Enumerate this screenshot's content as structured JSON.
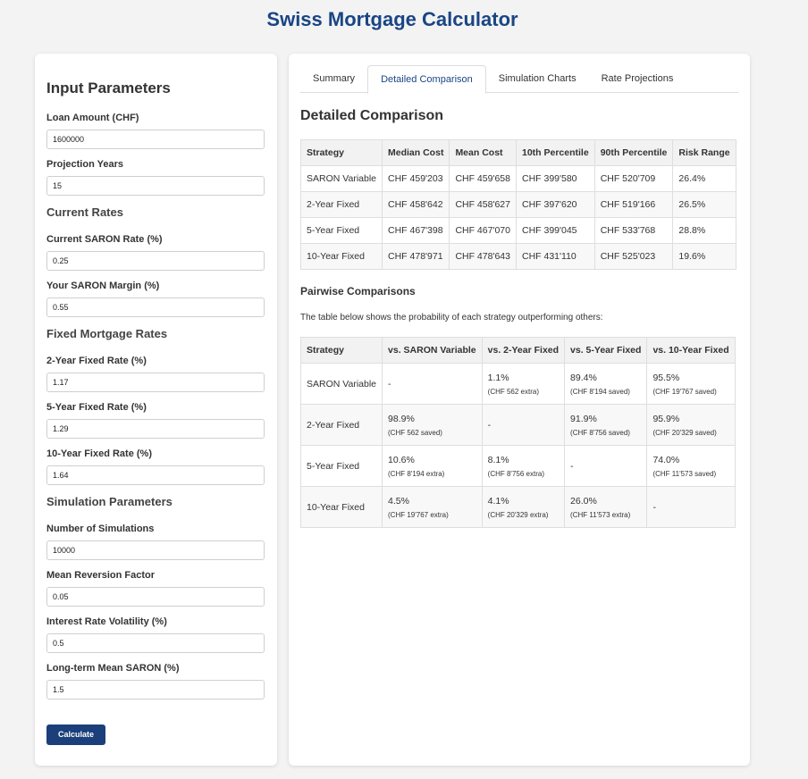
{
  "app": {
    "title": "Swiss Mortgage Calculator"
  },
  "sidebar": {
    "heading": "Input Parameters",
    "loan": {
      "label": "Loan Amount (CHF)",
      "value": "1600000"
    },
    "years": {
      "label": "Projection Years",
      "value": "15"
    },
    "current_rates_heading": "Current Rates",
    "saron": {
      "label": "Current SARON Rate (%)",
      "value": "0.25"
    },
    "margin": {
      "label": "Your SARON Margin (%)",
      "value": "0.55"
    },
    "fixed_heading": "Fixed Mortgage Rates",
    "fixed2": {
      "label": "2-Year Fixed Rate (%)",
      "value": "1.17"
    },
    "fixed5": {
      "label": "5-Year Fixed Rate (%)",
      "value": "1.29"
    },
    "fixed10": {
      "label": "10-Year Fixed Rate (%)",
      "value": "1.64"
    },
    "sim_heading": "Simulation Parameters",
    "nsims": {
      "label": "Number of Simulations",
      "value": "10000"
    },
    "reversion": {
      "label": "Mean Reversion Factor",
      "value": "0.05"
    },
    "volatility": {
      "label": "Interest Rate Volatility (%)",
      "value": "0.5"
    },
    "longterm": {
      "label": "Long-term Mean SARON (%)",
      "value": "1.5"
    },
    "calculate_label": "Calculate"
  },
  "tabs": [
    "Summary",
    "Detailed Comparison",
    "Simulation Charts",
    "Rate Projections"
  ],
  "active_tab": "Detailed Comparison",
  "main": {
    "title": "Detailed Comparison",
    "comparison": {
      "headers": [
        "Strategy",
        "Median Cost",
        "Mean Cost",
        "10th Percentile",
        "90th Percentile",
        "Risk Range"
      ],
      "rows": [
        [
          "SARON Variable",
          "CHF 459'203",
          "CHF 459'658",
          "CHF 399'580",
          "CHF 520'709",
          "26.4%"
        ],
        [
          "2-Year Fixed",
          "CHF 458'642",
          "CHF 458'627",
          "CHF 397'620",
          "CHF 519'166",
          "26.5%"
        ],
        [
          "5-Year Fixed",
          "CHF 467'398",
          "CHF 467'070",
          "CHF 399'045",
          "CHF 533'768",
          "28.8%"
        ],
        [
          "10-Year Fixed",
          "CHF 478'971",
          "CHF 478'643",
          "CHF 431'110",
          "CHF 525'023",
          "19.6%"
        ]
      ]
    },
    "pairwise_title": "Pairwise Comparisons",
    "pairwise_desc": "The table below shows the probability of each strategy outperforming others:",
    "pairwise": {
      "headers": [
        "Strategy",
        "vs. SARON Variable",
        "vs. 2-Year Fixed",
        "vs. 5-Year Fixed",
        "vs. 10-Year Fixed"
      ],
      "rows": [
        {
          "strategy": "SARON Variable",
          "cells": [
            {
              "pct": "-",
              "note": ""
            },
            {
              "pct": "1.1%",
              "note": "(CHF 562 extra)"
            },
            {
              "pct": "89.4%",
              "note": "(CHF 8'194 saved)"
            },
            {
              "pct": "95.5%",
              "note": "(CHF 19'767 saved)"
            }
          ]
        },
        {
          "strategy": "2-Year Fixed",
          "cells": [
            {
              "pct": "98.9%",
              "note": "(CHF 562 saved)"
            },
            {
              "pct": "-",
              "note": ""
            },
            {
              "pct": "91.9%",
              "note": "(CHF 8'756 saved)"
            },
            {
              "pct": "95.9%",
              "note": "(CHF 20'329 saved)"
            }
          ]
        },
        {
          "strategy": "5-Year Fixed",
          "cells": [
            {
              "pct": "10.6%",
              "note": "(CHF 8'194 extra)"
            },
            {
              "pct": "8.1%",
              "note": "(CHF 8'756 extra)"
            },
            {
              "pct": "-",
              "note": ""
            },
            {
              "pct": "74.0%",
              "note": "(CHF 11'573 saved)"
            }
          ]
        },
        {
          "strategy": "10-Year Fixed",
          "cells": [
            {
              "pct": "4.5%",
              "note": "(CHF 19'767 extra)"
            },
            {
              "pct": "4.1%",
              "note": "(CHF 20'329 extra)"
            },
            {
              "pct": "26.0%",
              "note": "(CHF 11'573 extra)"
            },
            {
              "pct": "-",
              "note": ""
            }
          ]
        }
      ]
    }
  }
}
